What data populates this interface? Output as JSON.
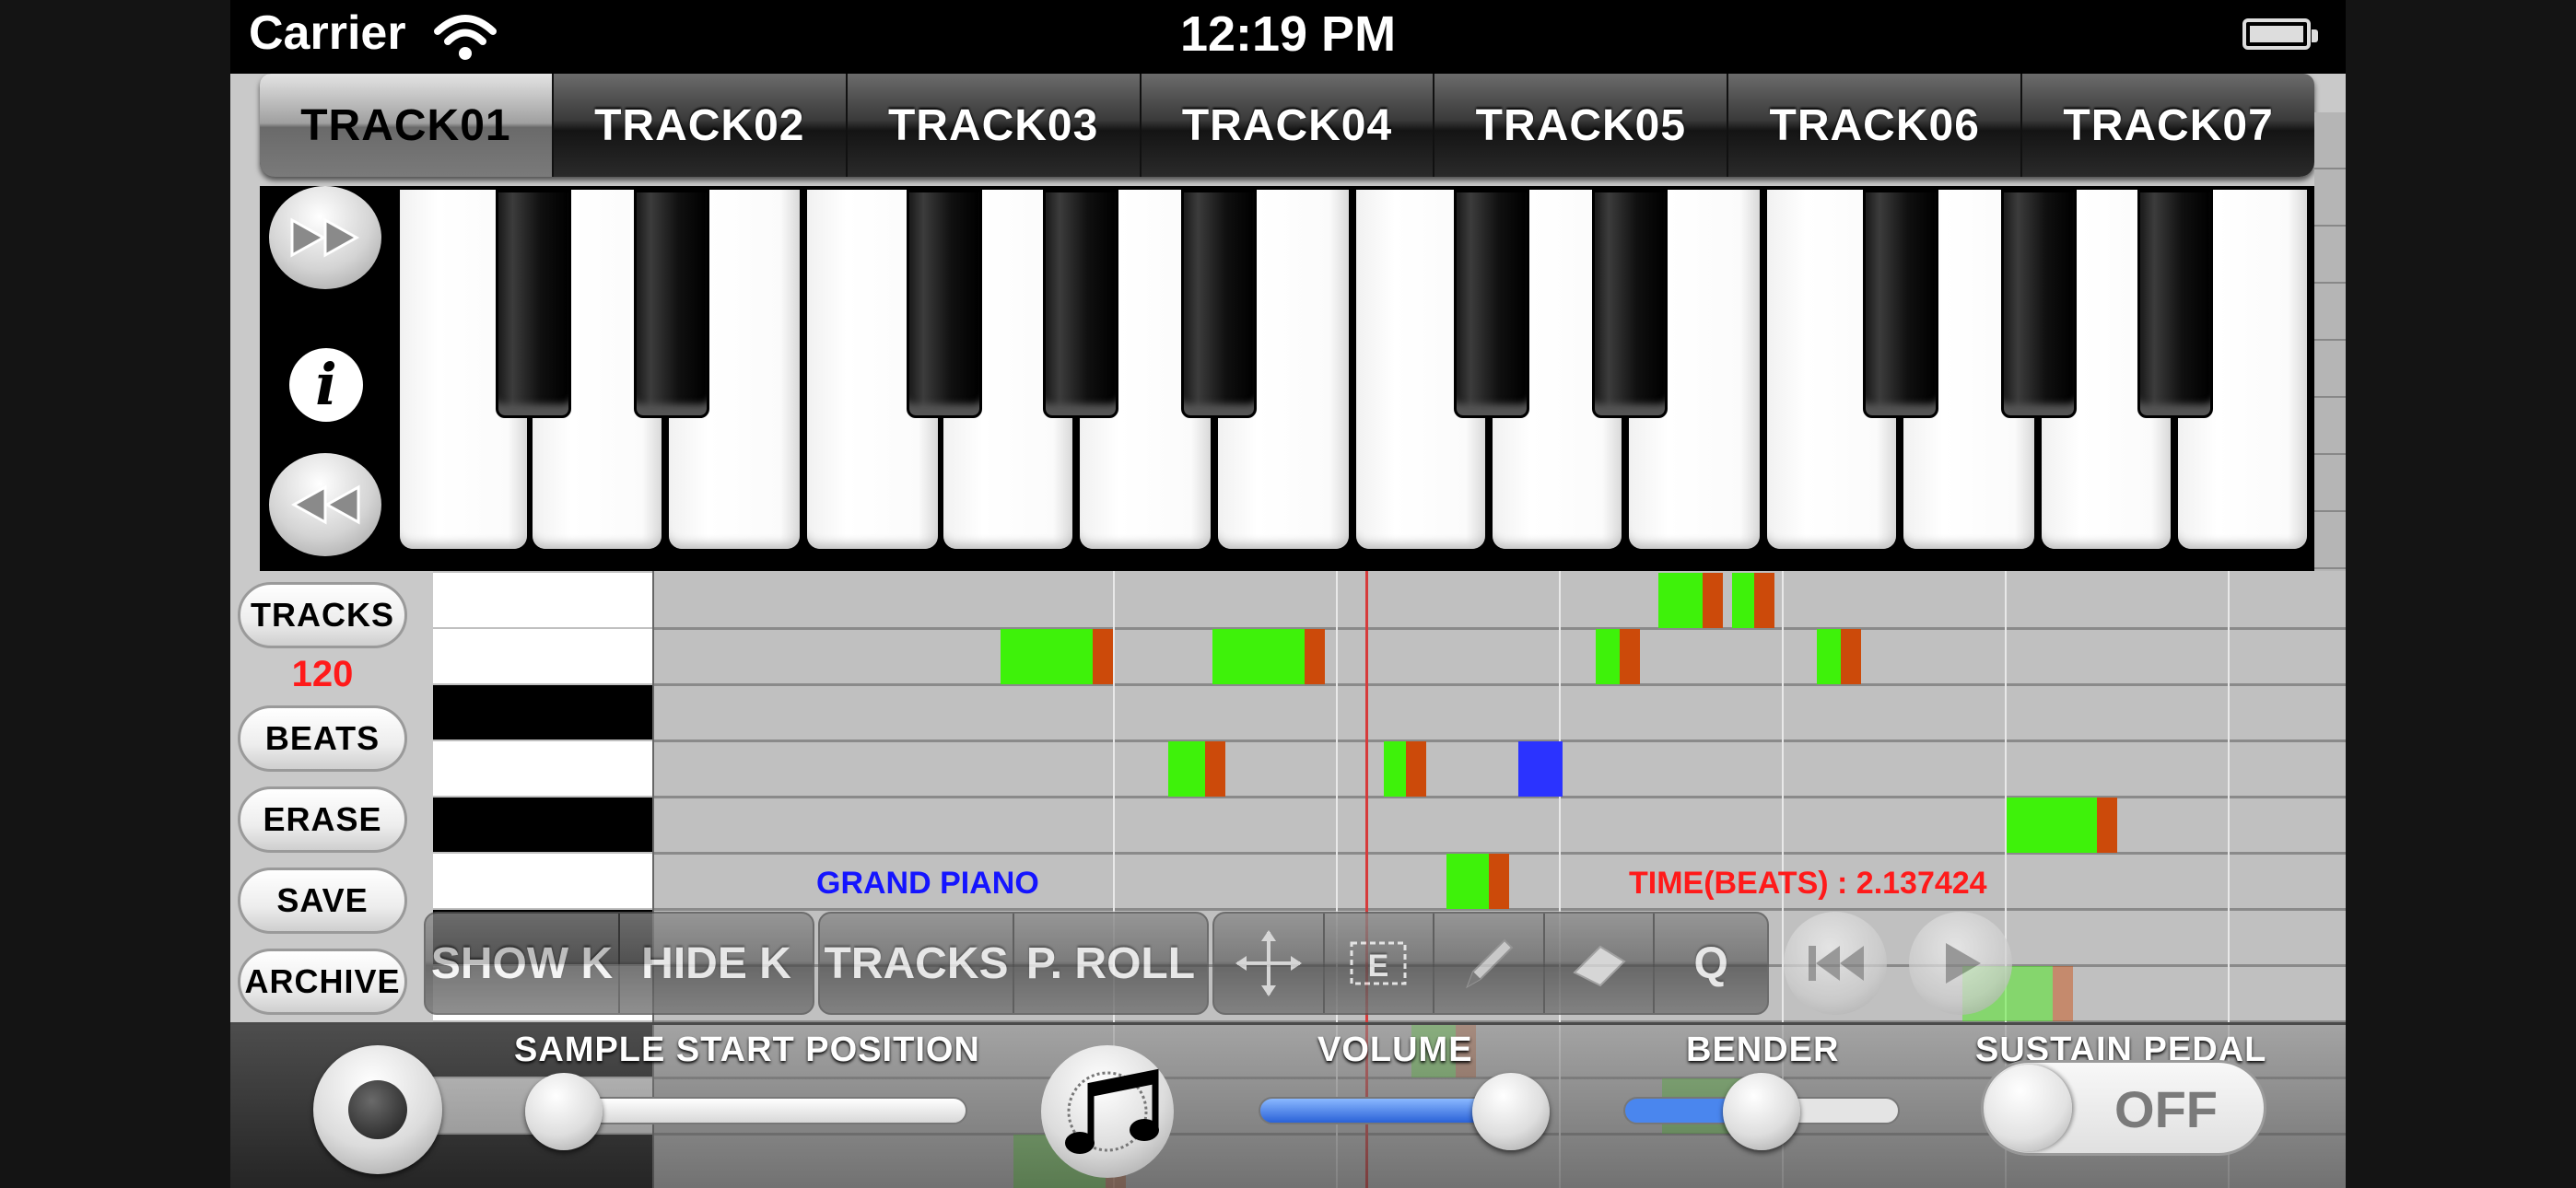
{
  "status_bar": {
    "carrier": "Carrier",
    "time": "12:19 PM"
  },
  "tracks": {
    "tabs": [
      "TRACK01",
      "TRACK02",
      "TRACK03",
      "TRACK04",
      "TRACK05",
      "TRACK06",
      "TRACK07"
    ],
    "active_index": 0
  },
  "side_panel": {
    "tracks_label": "TRACKS",
    "tempo": "120",
    "beats_label": "BEATS",
    "erase_label": "ERASE",
    "save_label": "SAVE",
    "archive_label": "ARCHIVE"
  },
  "roll": {
    "instrument": "GRAND PIANO",
    "time_readout": "TIME(BEATS) : 2.137424"
  },
  "toolbar": {
    "show_keys": "SHOW K",
    "hide_keys": "HIDE K",
    "tracks": "TRACKS",
    "piano_roll": "P. ROLL",
    "quantize": "Q"
  },
  "bottom_bar": {
    "sample_start_label": "SAMPLE START POSITION",
    "volume_label": "VOLUME",
    "bender_label": "BENDER",
    "sustain_label": "SUSTAIN PEDAL",
    "sustain_state": "OFF",
    "sample_start_value": 0.0,
    "volume_value": 1.0,
    "bender_value": 0.5
  },
  "colors": {
    "note": "#3ef20a",
    "note_tail": "#cc4a0a",
    "selected_note": "#2b33ff",
    "playhead": "#d63b3b",
    "tempo": "#ff1a1a",
    "instrument": "#1414ff"
  },
  "icons": {
    "fast_forward": "fast-forward-icon",
    "info": "info-icon",
    "rewind": "rewind-icon",
    "move": "move-icon",
    "select": "select-box-icon",
    "pencil": "pencil-icon",
    "eraser": "eraser-icon",
    "skip_back": "skip-back-icon",
    "play": "play-icon",
    "record": "record-icon",
    "music_note": "music-note-icon"
  }
}
